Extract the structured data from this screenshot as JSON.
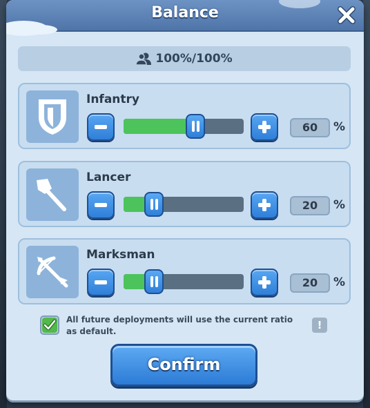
{
  "dialog": {
    "title": "Balance"
  },
  "ratio_bar": {
    "text": "100%/100%",
    "icon": "troops-icon"
  },
  "troops": [
    {
      "name": "Infantry",
      "value": "60",
      "percent_sign": "%",
      "icon": "shield-icon",
      "level": 0.6
    },
    {
      "name": "Lancer",
      "value": "20",
      "percent_sign": "%",
      "icon": "spear-icon",
      "level": 0.2
    },
    {
      "name": "Marksman",
      "value": "20",
      "percent_sign": "%",
      "icon": "crossbow-icon",
      "level": 0.2
    }
  ],
  "default_option": {
    "checked": true,
    "text": "All future deployments will use the current ratio as default."
  },
  "info_icon": "!",
  "confirm_label": "Confirm",
  "colors": {
    "header": "#5b80b6",
    "panel": "#d6e6f4",
    "fill": "#4cc35b",
    "button": "#2f7fd8"
  }
}
